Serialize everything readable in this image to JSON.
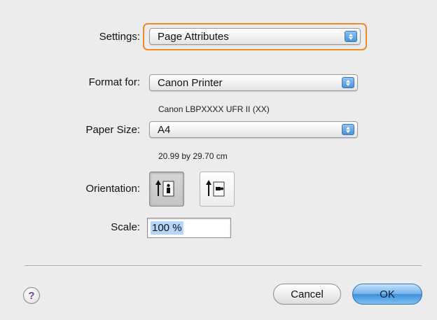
{
  "settings": {
    "label": "Settings:",
    "value": "Page Attributes"
  },
  "format_for": {
    "label": "Format for:",
    "value": "Canon Printer",
    "description": "Canon LBPXXXX UFR II (XX)"
  },
  "paper_size": {
    "label": "Paper Size:",
    "value": "A4",
    "description": "20.99 by 29.70 cm"
  },
  "orientation": {
    "label": "Orientation:",
    "options": [
      "portrait",
      "landscape"
    ],
    "selected": "portrait"
  },
  "scale": {
    "label": "Scale:",
    "value": "100 %"
  },
  "footer": {
    "help_glyph": "?",
    "cancel_label": "Cancel",
    "ok_label": "OK"
  },
  "colors": {
    "focus_ring": "#f08a2a",
    "accent": "#4c93d9",
    "background": "#ececec"
  }
}
